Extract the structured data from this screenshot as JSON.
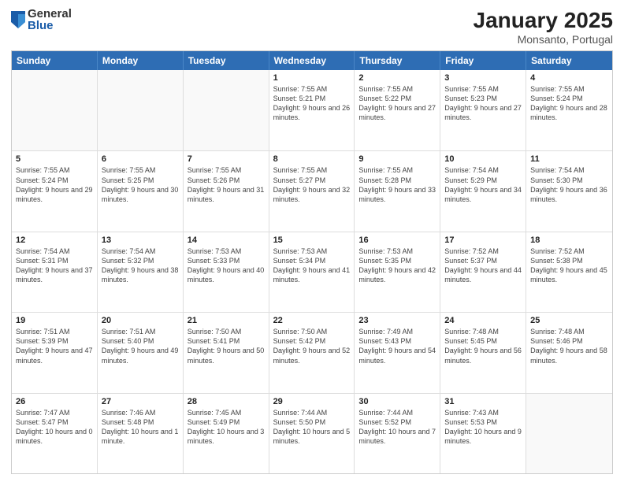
{
  "logo": {
    "general": "General",
    "blue": "Blue"
  },
  "header": {
    "month": "January 2025",
    "location": "Monsanto, Portugal"
  },
  "weekdays": [
    "Sunday",
    "Monday",
    "Tuesday",
    "Wednesday",
    "Thursday",
    "Friday",
    "Saturday"
  ],
  "weeks": [
    [
      {
        "day": "",
        "info": ""
      },
      {
        "day": "",
        "info": ""
      },
      {
        "day": "",
        "info": ""
      },
      {
        "day": "1",
        "info": "Sunrise: 7:55 AM\nSunset: 5:21 PM\nDaylight: 9 hours and 26 minutes."
      },
      {
        "day": "2",
        "info": "Sunrise: 7:55 AM\nSunset: 5:22 PM\nDaylight: 9 hours and 27 minutes."
      },
      {
        "day": "3",
        "info": "Sunrise: 7:55 AM\nSunset: 5:23 PM\nDaylight: 9 hours and 27 minutes."
      },
      {
        "day": "4",
        "info": "Sunrise: 7:55 AM\nSunset: 5:24 PM\nDaylight: 9 hours and 28 minutes."
      }
    ],
    [
      {
        "day": "5",
        "info": "Sunrise: 7:55 AM\nSunset: 5:24 PM\nDaylight: 9 hours and 29 minutes."
      },
      {
        "day": "6",
        "info": "Sunrise: 7:55 AM\nSunset: 5:25 PM\nDaylight: 9 hours and 30 minutes."
      },
      {
        "day": "7",
        "info": "Sunrise: 7:55 AM\nSunset: 5:26 PM\nDaylight: 9 hours and 31 minutes."
      },
      {
        "day": "8",
        "info": "Sunrise: 7:55 AM\nSunset: 5:27 PM\nDaylight: 9 hours and 32 minutes."
      },
      {
        "day": "9",
        "info": "Sunrise: 7:55 AM\nSunset: 5:28 PM\nDaylight: 9 hours and 33 minutes."
      },
      {
        "day": "10",
        "info": "Sunrise: 7:54 AM\nSunset: 5:29 PM\nDaylight: 9 hours and 34 minutes."
      },
      {
        "day": "11",
        "info": "Sunrise: 7:54 AM\nSunset: 5:30 PM\nDaylight: 9 hours and 36 minutes."
      }
    ],
    [
      {
        "day": "12",
        "info": "Sunrise: 7:54 AM\nSunset: 5:31 PM\nDaylight: 9 hours and 37 minutes."
      },
      {
        "day": "13",
        "info": "Sunrise: 7:54 AM\nSunset: 5:32 PM\nDaylight: 9 hours and 38 minutes."
      },
      {
        "day": "14",
        "info": "Sunrise: 7:53 AM\nSunset: 5:33 PM\nDaylight: 9 hours and 40 minutes."
      },
      {
        "day": "15",
        "info": "Sunrise: 7:53 AM\nSunset: 5:34 PM\nDaylight: 9 hours and 41 minutes."
      },
      {
        "day": "16",
        "info": "Sunrise: 7:53 AM\nSunset: 5:35 PM\nDaylight: 9 hours and 42 minutes."
      },
      {
        "day": "17",
        "info": "Sunrise: 7:52 AM\nSunset: 5:37 PM\nDaylight: 9 hours and 44 minutes."
      },
      {
        "day": "18",
        "info": "Sunrise: 7:52 AM\nSunset: 5:38 PM\nDaylight: 9 hours and 45 minutes."
      }
    ],
    [
      {
        "day": "19",
        "info": "Sunrise: 7:51 AM\nSunset: 5:39 PM\nDaylight: 9 hours and 47 minutes."
      },
      {
        "day": "20",
        "info": "Sunrise: 7:51 AM\nSunset: 5:40 PM\nDaylight: 9 hours and 49 minutes."
      },
      {
        "day": "21",
        "info": "Sunrise: 7:50 AM\nSunset: 5:41 PM\nDaylight: 9 hours and 50 minutes."
      },
      {
        "day": "22",
        "info": "Sunrise: 7:50 AM\nSunset: 5:42 PM\nDaylight: 9 hours and 52 minutes."
      },
      {
        "day": "23",
        "info": "Sunrise: 7:49 AM\nSunset: 5:43 PM\nDaylight: 9 hours and 54 minutes."
      },
      {
        "day": "24",
        "info": "Sunrise: 7:48 AM\nSunset: 5:45 PM\nDaylight: 9 hours and 56 minutes."
      },
      {
        "day": "25",
        "info": "Sunrise: 7:48 AM\nSunset: 5:46 PM\nDaylight: 9 hours and 58 minutes."
      }
    ],
    [
      {
        "day": "26",
        "info": "Sunrise: 7:47 AM\nSunset: 5:47 PM\nDaylight: 10 hours and 0 minutes."
      },
      {
        "day": "27",
        "info": "Sunrise: 7:46 AM\nSunset: 5:48 PM\nDaylight: 10 hours and 1 minute."
      },
      {
        "day": "28",
        "info": "Sunrise: 7:45 AM\nSunset: 5:49 PM\nDaylight: 10 hours and 3 minutes."
      },
      {
        "day": "29",
        "info": "Sunrise: 7:44 AM\nSunset: 5:50 PM\nDaylight: 10 hours and 5 minutes."
      },
      {
        "day": "30",
        "info": "Sunrise: 7:44 AM\nSunset: 5:52 PM\nDaylight: 10 hours and 7 minutes."
      },
      {
        "day": "31",
        "info": "Sunrise: 7:43 AM\nSunset: 5:53 PM\nDaylight: 10 hours and 9 minutes."
      },
      {
        "day": "",
        "info": ""
      }
    ]
  ]
}
